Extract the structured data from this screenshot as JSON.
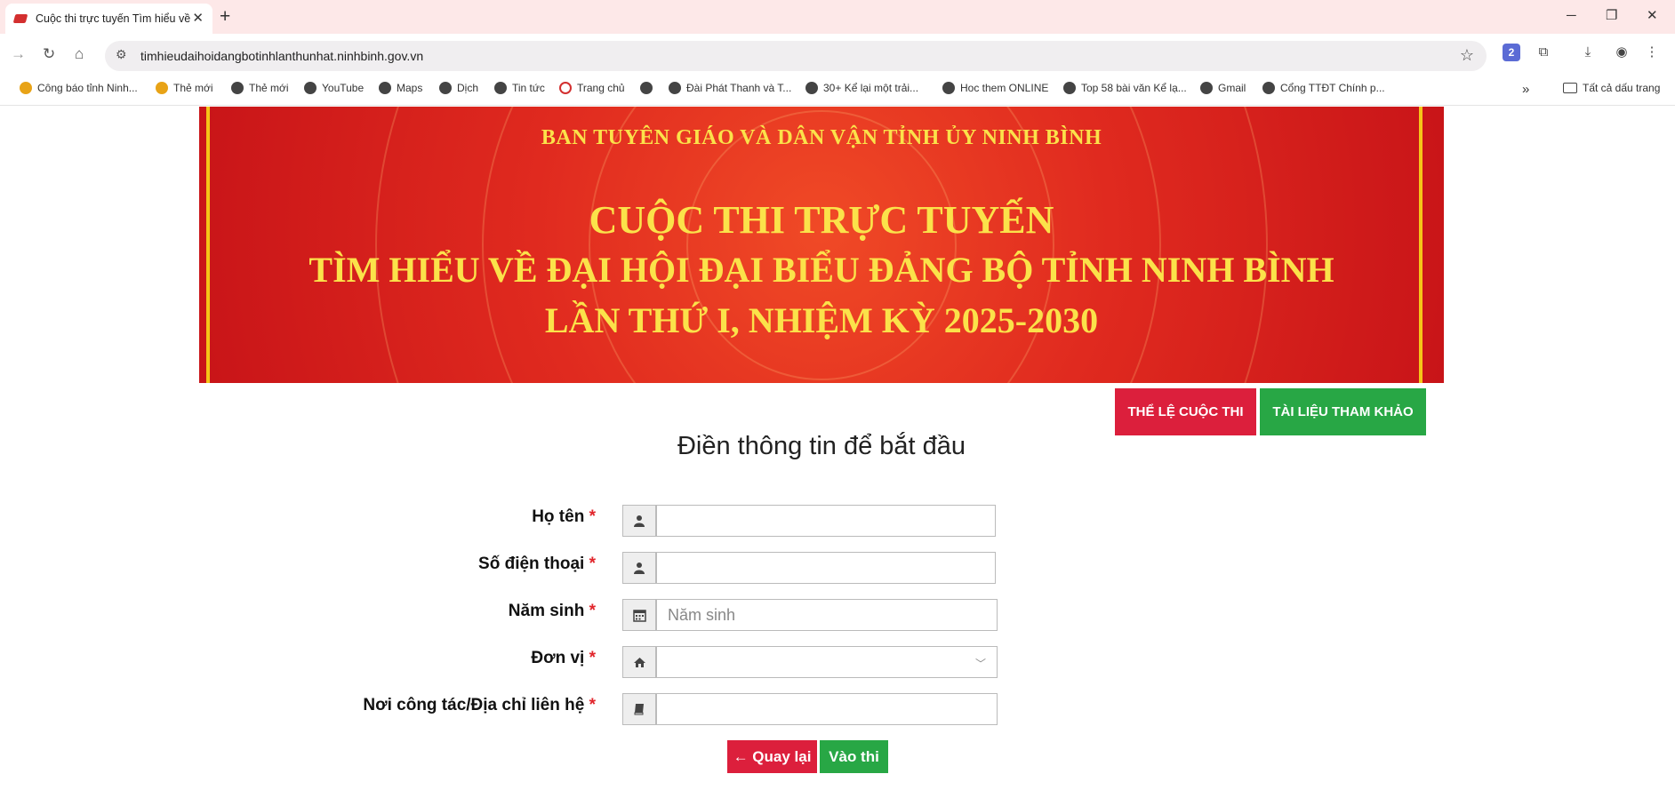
{
  "browser": {
    "tab_title": "Cuộc thi trực tuyến Tìm hiểu về",
    "tab_close": "✕",
    "new_tab": "+",
    "url": "timhieudaihoidangbotinhlanthunhat.ninhbinh.gov.vn",
    "bookmarks": [
      {
        "label": "Công báo tỉnh Ninh...",
        "icon": "star-badge-icon"
      },
      {
        "label": "Thẻ mới",
        "icon": "star-badge-icon"
      },
      {
        "label": "Thẻ mới",
        "icon": "globe-icon"
      },
      {
        "label": "YouTube",
        "icon": "globe-icon"
      },
      {
        "label": "Maps",
        "icon": "globe-icon"
      },
      {
        "label": "Dịch",
        "icon": "globe-icon"
      },
      {
        "label": "Tin tức",
        "icon": "globe-icon"
      },
      {
        "label": "Trang chủ",
        "icon": "ring-icon"
      },
      {
        "label": "",
        "icon": "globe-icon"
      },
      {
        "label": "Đài Phát Thanh và T...",
        "icon": "globe-icon"
      },
      {
        "label": "30+ Kể lại một trải...",
        "icon": "globe-icon"
      },
      {
        "label": "Hoc them ONLINE",
        "icon": "globe-icon"
      },
      {
        "label": "Top 58 bài văn Kể lạ...",
        "icon": "globe-icon"
      },
      {
        "label": "Gmail",
        "icon": "globe-icon"
      },
      {
        "label": "Cổng TTĐT Chính p...",
        "icon": "globe-icon"
      }
    ],
    "bookmarks_more": "»",
    "all_bookmarks": "Tất cả dấu trang"
  },
  "banner": {
    "line1": "BAN TUYÊN GIÁO VÀ DÂN VẬN TỈNH ỦY NINH BÌNH",
    "line2": "CUỘC THI TRỰC TUYẾN",
    "line3": "TÌM HIỂU VỀ ĐẠI HỘI ĐẠI BIỂU ĐẢNG BỘ TỈNH NINH BÌNH",
    "line4": "LẦN THỨ I, NHIỆM KỲ 2025-2030"
  },
  "actions": {
    "rules": "THỂ LỆ CUỘC THI",
    "docs": "TÀI LIỆU THAM KHẢO"
  },
  "form": {
    "heading": "Điền thông tin để bắt đầu",
    "required_mark": "*",
    "fields": {
      "name": {
        "label": "Họ tên",
        "value": "",
        "icon": "user-icon"
      },
      "phone": {
        "label": "Số điện thoại",
        "value": "",
        "icon": "user-icon"
      },
      "birth_year": {
        "label": "Năm sinh",
        "placeholder": "Năm sinh",
        "icon": "calendar-icon"
      },
      "unit": {
        "label": "Đơn vị",
        "value": "",
        "icon": "home-icon"
      },
      "address": {
        "label": "Nơi công tác/Địa chỉ liên hệ",
        "value": "",
        "icon": "book-icon"
      }
    },
    "back_button": "Quay lại",
    "back_icon": "←",
    "start_button": "Vào thi"
  },
  "colors": {
    "danger": "#dc1f3c",
    "success": "#28a745",
    "banner_red": "#e02a1f",
    "banner_gold": "#fbe24a"
  }
}
